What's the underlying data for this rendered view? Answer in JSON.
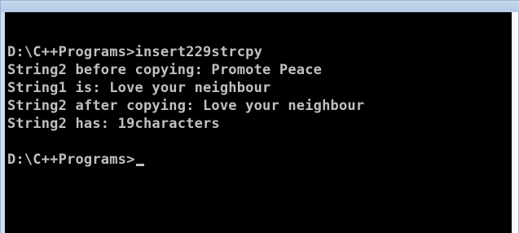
{
  "window": {
    "accent_color": "#b3c9e6",
    "background_color": "#000000",
    "text_color": "#c0c0c0"
  },
  "console": {
    "lines": [
      "D:\\C++Programs>insert229strcpy",
      "String2 before copying: Promote Peace",
      "String1 is: Love your neighbour",
      "String2 after copying: Love your neighbour",
      "String2 has: 19characters",
      "",
      "D:\\C++Programs>"
    ],
    "cursor": "_"
  }
}
